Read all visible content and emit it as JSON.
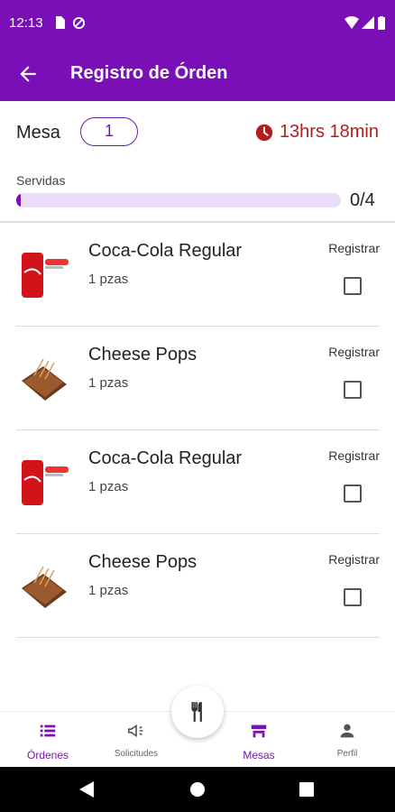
{
  "status_bar": {
    "time": "12:13"
  },
  "app_bar": {
    "title": "Registro de Órden"
  },
  "order": {
    "mesa_label": "Mesa",
    "mesa_number": "1",
    "elapsed": "13hrs 18min",
    "servidas_label": "Servidas",
    "served_count": "0/4",
    "served_fraction": 0.0
  },
  "items": [
    {
      "name": "Coca-Cola Regular",
      "qty": "1 pzas",
      "register_label": "Registrar",
      "checked": false,
      "image": "coca-cola-can"
    },
    {
      "name": "Cheese Pops",
      "qty": "1 pzas",
      "register_label": "Registrar",
      "checked": false,
      "image": "cheese-pops"
    },
    {
      "name": "Coca-Cola Regular",
      "qty": "1 pzas",
      "register_label": "Registrar",
      "checked": false,
      "image": "coca-cola-can"
    },
    {
      "name": "Cheese Pops",
      "qty": "1 pzas",
      "register_label": "Registrar",
      "checked": false,
      "image": "cheese-pops"
    }
  ],
  "bottom_nav": {
    "ordenes": "Órdenes",
    "solicitudes": "Solicitudes",
    "mesas": "Mesas",
    "perfil": "Perfil"
  },
  "colors": {
    "primary": "#7a0fb8",
    "timer": "#b71c1c",
    "progress_track": "#e9dcf5"
  }
}
